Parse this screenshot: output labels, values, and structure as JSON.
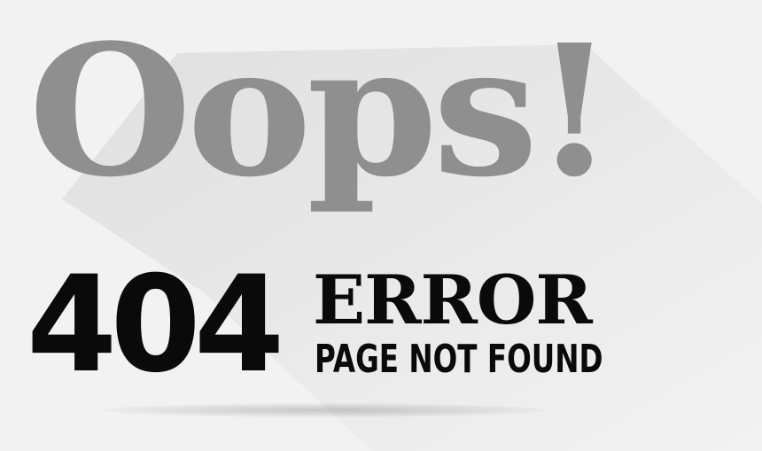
{
  "headline": "Oops!",
  "code": "404",
  "error_word": "ERROR",
  "error_sub": "PAGE NOT FOUND",
  "colors": {
    "background": "#f2f2f2",
    "headline": "#8f8f8f",
    "long_shadow": "#e3e3e3",
    "text": "#0a0a0a"
  }
}
